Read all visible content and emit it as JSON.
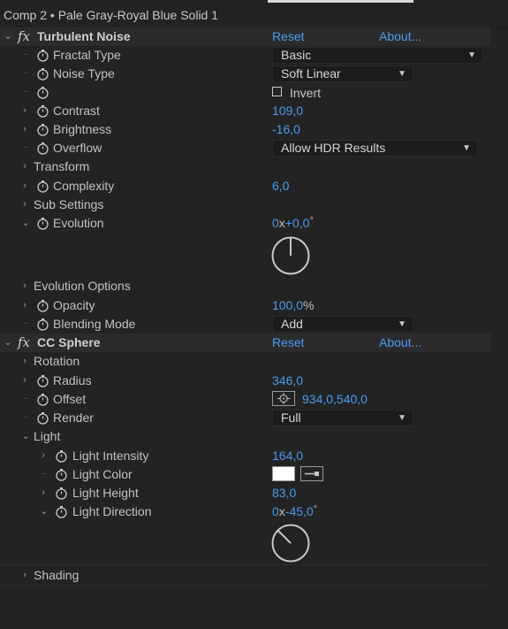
{
  "window": {
    "title": "Comp 2 • Pale Gray-Royal Blue Solid 1"
  },
  "effects": [
    {
      "name": "Turbulent Noise",
      "reset_label": "Reset",
      "about_label": "About...",
      "props": {
        "fractal_type": {
          "label": "Fractal Type",
          "value": "Basic"
        },
        "noise_type": {
          "label": "Noise Type",
          "value": "Soft Linear"
        },
        "invert": {
          "label": "Invert",
          "checked": false
        },
        "contrast": {
          "label": "Contrast",
          "value": "109,0"
        },
        "brightness": {
          "label": "Brightness",
          "value": "-16,0"
        },
        "overflow": {
          "label": "Overflow",
          "value": "Allow HDR Results"
        },
        "transform": {
          "label": "Transform"
        },
        "complexity": {
          "label": "Complexity",
          "value": "6,0"
        },
        "sub_settings": {
          "label": "Sub Settings"
        },
        "evolution": {
          "label": "Evolution",
          "revolutions": "0",
          "x": "x",
          "degrees": "+0,0",
          "deg_symbol": "°"
        },
        "evolution_options": {
          "label": "Evolution Options"
        },
        "opacity": {
          "label": "Opacity",
          "value": "100,0",
          "unit": "%"
        },
        "blending_mode": {
          "label": "Blending Mode",
          "value": "Add"
        }
      }
    },
    {
      "name": "CC Sphere",
      "reset_label": "Reset",
      "about_label": "About...",
      "props": {
        "rotation": {
          "label": "Rotation"
        },
        "radius": {
          "label": "Radius",
          "value": "346,0"
        },
        "offset": {
          "label": "Offset",
          "value": "934,0,540,0"
        },
        "render": {
          "label": "Render",
          "value": "Full"
        },
        "light": {
          "label": "Light"
        },
        "light_intensity": {
          "label": "Light Intensity",
          "value": "164,0"
        },
        "light_color": {
          "label": "Light Color",
          "color": "#ffffff"
        },
        "light_height": {
          "label": "Light Height",
          "value": "83,0"
        },
        "light_direction": {
          "label": "Light Direction",
          "revolutions": "0",
          "x": "x",
          "degrees": "-45,0",
          "deg_symbol": "°"
        },
        "shading": {
          "label": "Shading"
        }
      }
    }
  ],
  "colors": {
    "accent": "#4a9cf0",
    "background": "#232323",
    "header": "#2b2b2b"
  }
}
